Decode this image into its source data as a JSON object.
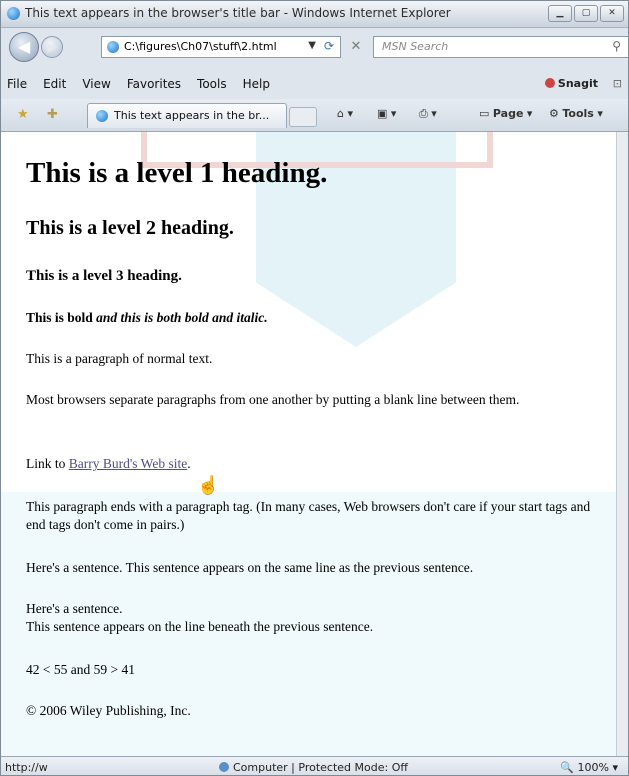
{
  "window": {
    "title": "This text appears in the browser's title bar - Windows Internet Explorer"
  },
  "address": {
    "url": "C:\\figures\\Ch07\\stuff\\2.html",
    "search_placeholder": "MSN Search"
  },
  "menu": [
    "File",
    "Edit",
    "View",
    "Favorites",
    "Tools",
    "Help"
  ],
  "toolbar": {
    "snagit": "Snagit",
    "tab_title": "This text appears in the br...",
    "page_label": "Page",
    "tools_label": "Tools"
  },
  "page": {
    "h1": "This is a level 1 heading.",
    "h2": "This is a level 2 heading.",
    "h3": "This is a level 3 heading.",
    "bold_text": "This is bold ",
    "bold_italic_text": "and this is both bold and italic.",
    "para1": "This is a paragraph of normal text.",
    "para2": "Most browsers separate paragraphs from one another by putting a blank line between them.",
    "link_prefix": "Link to ",
    "link_text": "Barry Burd's Web site",
    "link_suffix": ".",
    "para3": "This paragraph ends with a paragraph tag. (In many cases, Web browsers don't care if your start tags and end tags don't come in pairs.)",
    "para4": "Here's a sentence. This sentence appears on the same line as the previous sentence.",
    "para5_line1": "Here's a sentence.",
    "para5_line2": "This sentence appears on the line beneath the previous sentence.",
    "para6": "42 < 55 and 59 > 41",
    "para7": "© 2006 Wiley Publishing, Inc."
  },
  "status": {
    "left": "http://w",
    "zone": "Computer | Protected Mode: Off",
    "zoom": "100%"
  }
}
